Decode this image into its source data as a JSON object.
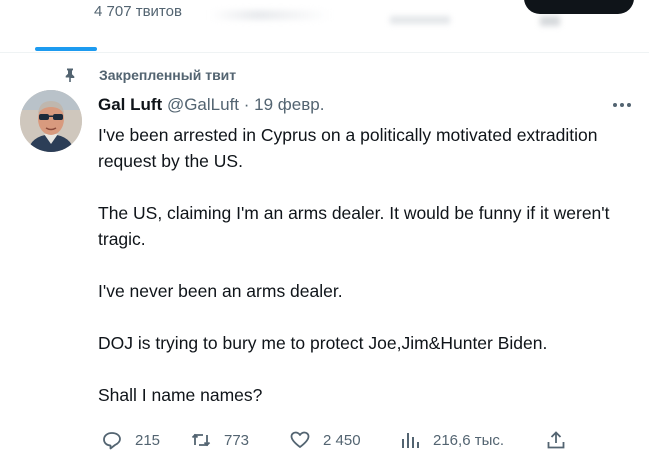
{
  "profile": {
    "tweet_count": "4 707 твитов"
  },
  "pinned": {
    "label": "Закрепленный твит"
  },
  "tweet": {
    "author_name": "Gal Luft",
    "handle": "@GalLuft",
    "separator": "·",
    "date": "19 февр.",
    "paragraphs": [
      "I've been arrested in Cyprus on a politically motivated extradition request by the US.",
      "The US, claiming I'm an arms dealer.  It would be funny if it weren't tragic.",
      "I've never been an arms dealer.",
      "DOJ is trying to bury me to protect Joe,Jim&Hunter Biden.",
      "Shall I name names?"
    ],
    "stats": {
      "replies": "215",
      "retweets": "773",
      "likes": "2 450",
      "views": "216,6 тыс."
    }
  },
  "icons": {
    "pin": "pin-icon",
    "more": "more-icon",
    "reply": "reply-icon",
    "retweet": "retweet-icon",
    "like": "heart-icon",
    "views": "views-icon",
    "share": "share-icon"
  },
  "colors": {
    "accent": "#1d9bf0",
    "text": "#0f1419",
    "muted": "#536471"
  }
}
